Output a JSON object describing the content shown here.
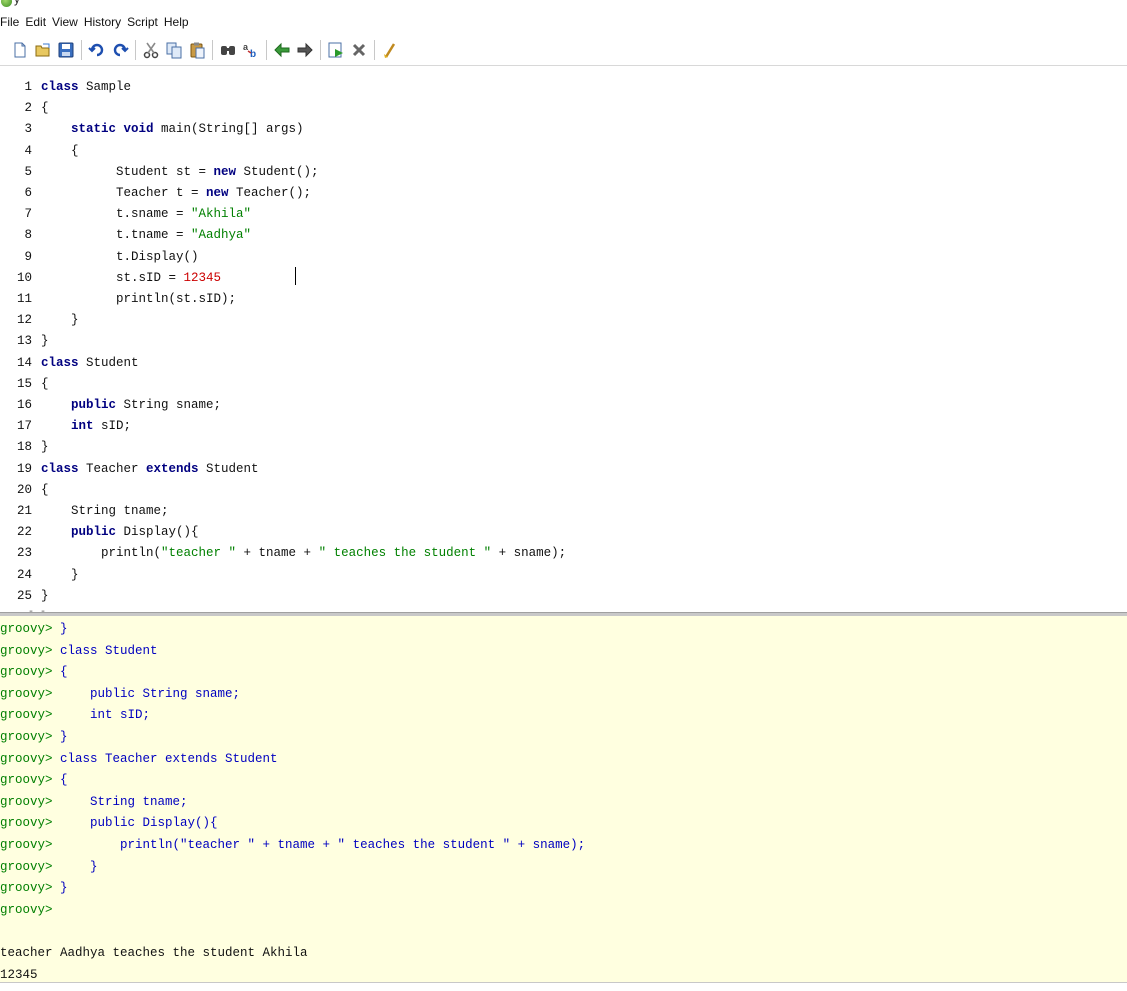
{
  "window": {
    "title_fragment": "y"
  },
  "menu": [
    "File",
    "Edit",
    "View",
    "History",
    "Script",
    "Help"
  ],
  "toolbar": [
    "new-file-icon",
    "open-file-icon",
    "save-icon",
    "sep",
    "undo-icon",
    "redo-icon",
    "sep",
    "cut-icon",
    "copy-icon",
    "paste-icon",
    "sep",
    "find-icon",
    "replace-icon",
    "sep",
    "history-previous-icon",
    "history-next-icon",
    "sep",
    "run-script-icon",
    "interrupt-icon",
    "sep",
    "clear-output-icon"
  ],
  "editor": {
    "lines": [
      {
        "n": "1",
        "t": [
          [
            "kw",
            "class"
          ],
          [
            "c",
            " Sample"
          ]
        ]
      },
      {
        "n": "2",
        "t": [
          [
            "c",
            "{"
          ]
        ]
      },
      {
        "n": "3",
        "t": [
          [
            "c",
            "    "
          ],
          [
            "kw",
            "static void"
          ],
          [
            "c",
            " main(String[] args)"
          ]
        ]
      },
      {
        "n": "4",
        "t": [
          [
            "c",
            "    {"
          ]
        ]
      },
      {
        "n": "5",
        "t": [
          [
            "c",
            "          Student st = "
          ],
          [
            "kw",
            "new"
          ],
          [
            "c",
            " Student();"
          ]
        ]
      },
      {
        "n": "6",
        "t": [
          [
            "c",
            "          Teacher t = "
          ],
          [
            "kw",
            "new"
          ],
          [
            "c",
            " Teacher();"
          ]
        ]
      },
      {
        "n": "7",
        "t": [
          [
            "c",
            "          t.sname = "
          ],
          [
            "str",
            "\"Akhila\""
          ]
        ]
      },
      {
        "n": "8",
        "t": [
          [
            "c",
            "          t.tname = "
          ],
          [
            "str",
            "\"Aadhya\""
          ]
        ]
      },
      {
        "n": "9",
        "t": [
          [
            "c",
            "          t.Display()"
          ]
        ]
      },
      {
        "n": "10",
        "t": [
          [
            "c",
            "          st.sID = "
          ],
          [
            "num",
            "12345"
          ]
        ]
      },
      {
        "n": "11",
        "t": [
          [
            "c",
            "          println(st.sID);"
          ]
        ]
      },
      {
        "n": "12",
        "t": [
          [
            "c",
            "    }"
          ]
        ]
      },
      {
        "n": "13",
        "t": [
          [
            "c",
            "}"
          ]
        ]
      },
      {
        "n": "14",
        "t": [
          [
            "kw",
            "class"
          ],
          [
            "c",
            " Student"
          ]
        ]
      },
      {
        "n": "15",
        "t": [
          [
            "c",
            "{"
          ]
        ]
      },
      {
        "n": "16",
        "t": [
          [
            "c",
            "    "
          ],
          [
            "kw",
            "public"
          ],
          [
            "c",
            " String sname;"
          ]
        ]
      },
      {
        "n": "17",
        "t": [
          [
            "c",
            "    "
          ],
          [
            "kw",
            "int"
          ],
          [
            "c",
            " sID;"
          ]
        ]
      },
      {
        "n": "18",
        "t": [
          [
            "c",
            "}"
          ]
        ]
      },
      {
        "n": "19",
        "t": [
          [
            "kw",
            "class"
          ],
          [
            "c",
            " Teacher "
          ],
          [
            "kw",
            "extends"
          ],
          [
            "c",
            " Student"
          ]
        ]
      },
      {
        "n": "20",
        "t": [
          [
            "c",
            "{"
          ]
        ]
      },
      {
        "n": "21",
        "t": [
          [
            "c",
            "    String tname;"
          ]
        ]
      },
      {
        "n": "22",
        "t": [
          [
            "c",
            "    "
          ],
          [
            "kw",
            "public"
          ],
          [
            "c",
            " Display(){"
          ]
        ]
      },
      {
        "n": "23",
        "t": [
          [
            "c",
            "        println("
          ],
          [
            "str",
            "\"teacher \""
          ],
          [
            "c",
            " + tname + "
          ],
          [
            "str",
            "\" teaches the student \""
          ],
          [
            "c",
            " + sname);"
          ]
        ]
      },
      {
        "n": "24",
        "t": [
          [
            "c",
            "    }"
          ]
        ]
      },
      {
        "n": "25",
        "t": [
          [
            "c",
            "}"
          ]
        ]
      }
    ]
  },
  "console": {
    "prompt": "groovy>",
    "input_lines": [
      " }",
      " class Student",
      " {",
      "     public String sname;",
      "     int sID;",
      " }",
      " class Teacher extends Student",
      " {",
      "     String tname;",
      "     public Display(){",
      "         println(\"teacher \" + tname + \" teaches the student \" + sname);",
      "     }",
      " }",
      ""
    ],
    "output_lines": [
      "teacher Aadhya teaches the student Akhila",
      "12345"
    ]
  }
}
